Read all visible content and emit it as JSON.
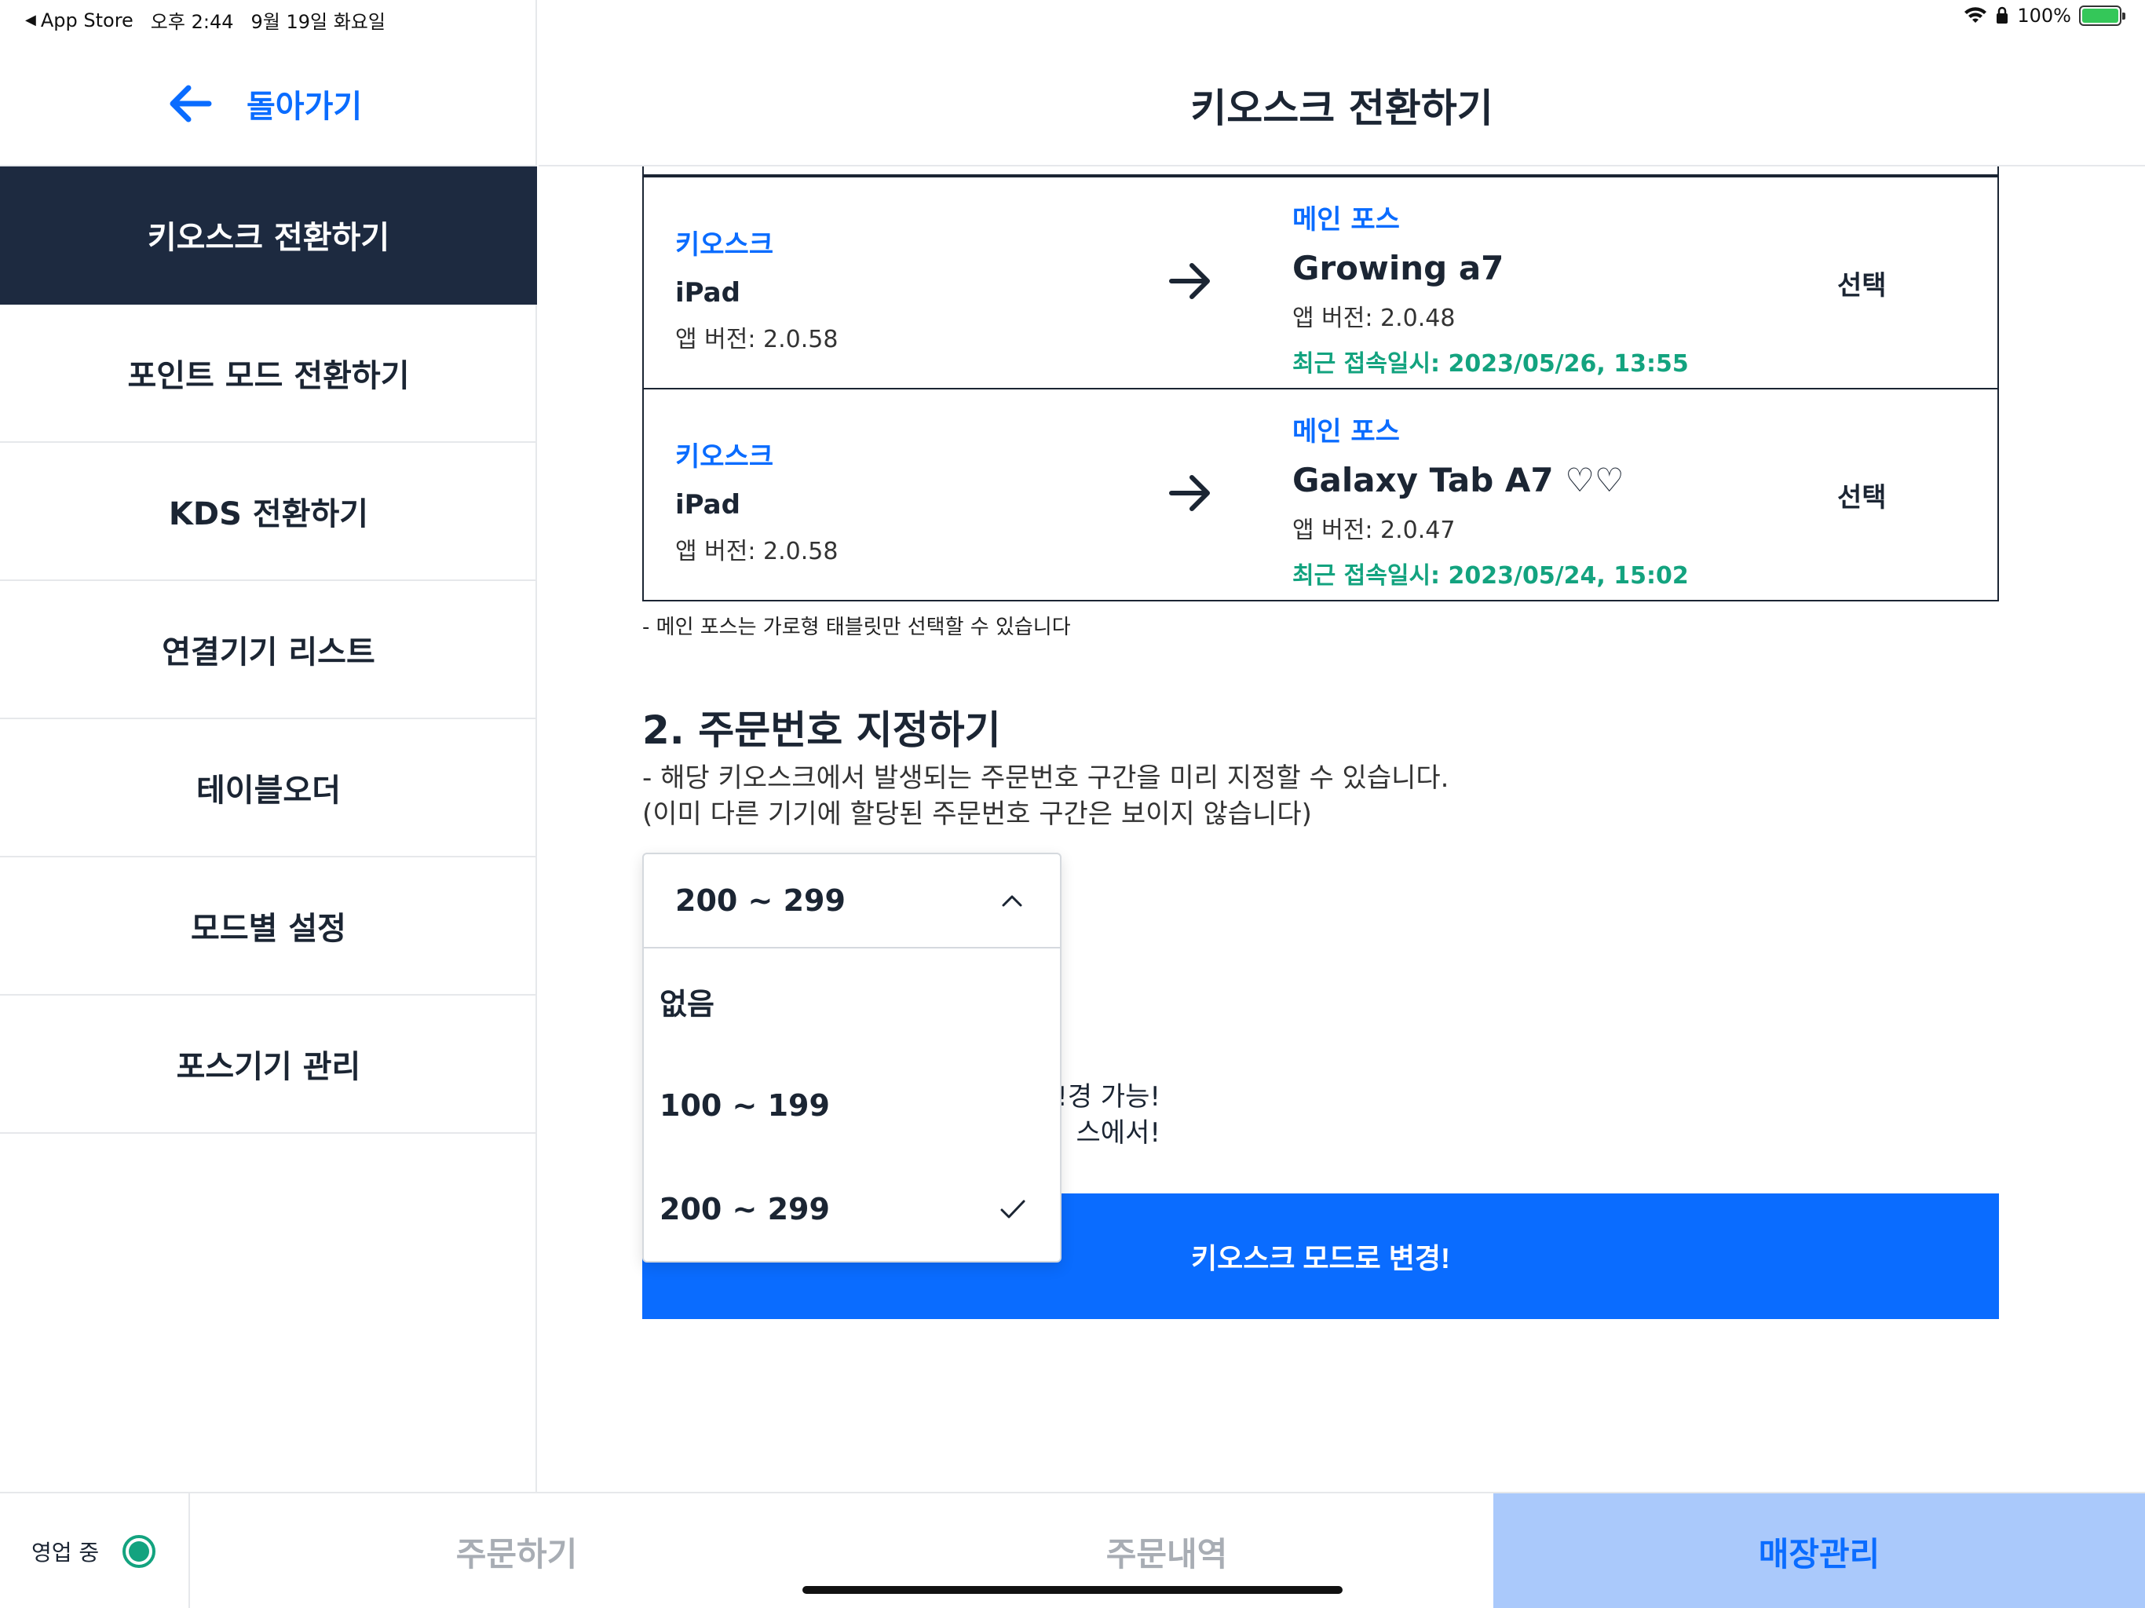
{
  "status_bar": {
    "back_app": "App Store",
    "time": "오후 2:44",
    "date": "9월 19일 화요일",
    "battery": "100%",
    "battery_color": "#34c759"
  },
  "sidebar": {
    "back_label": "돌아가기",
    "items": [
      {
        "label": "키오스크 전환하기",
        "active": true
      },
      {
        "label": "포인트 모드 전환하기"
      },
      {
        "label": "KDS 전환하기"
      },
      {
        "label": "연결기기 리스트"
      },
      {
        "label": "테이블오더"
      },
      {
        "label": "모드별 설정"
      },
      {
        "label": "포스기기 관리"
      }
    ]
  },
  "header": {
    "title": "키오스크 전환하기"
  },
  "devices": [
    {
      "source_tag": "키오스크",
      "source_name": "iPad",
      "source_version": "앱 버전: 2.0.58",
      "target_tag": "메인 포스",
      "target_name": "Growing a7",
      "target_version": "앱 버전: 2.0.48",
      "last_connected": "최근 접속일시: 2023/05/26, 13:55",
      "select_label": "선택"
    },
    {
      "source_tag": "키오스크",
      "source_name": "iPad",
      "source_version": "앱 버전: 2.0.58",
      "target_tag": "메인 포스",
      "target_name": "Galaxy Tab A7 ♡♡",
      "target_version": "앱 버전: 2.0.47",
      "last_connected": "최근 접속일시: 2023/05/24, 15:02",
      "select_label": "선택"
    }
  ],
  "note": "- 메인 포스는 가로형 태블릿만 선택할 수 있습니다",
  "section2": {
    "title": "2. 주문번호 지정하기",
    "desc_line1": "- 해당 키오스크에서 발생되는 주문번호 구간을 미리 지정할 수 있습니다.",
    "desc_line2": "(이미 다른 기기에 할당된 주문번호 구간은 보이지 않습니다)",
    "partial_line1": "!경 가능!",
    "partial_line2": "스에서!"
  },
  "dropdown": {
    "selected": "200 ~ 299",
    "options": [
      "없음",
      "100 ~ 199",
      "200 ~ 299"
    ]
  },
  "primary_button": "키오스크 모드로 변경!",
  "bottom_bar": {
    "status": "영업 중",
    "tabs": [
      "주문하기",
      "주문내역",
      "매장관리"
    ]
  },
  "colors": {
    "accent": "#0a6cff",
    "sidebar_active": "#1d2a40",
    "success": "#13a37f",
    "tab_active_bg": "#aac9fb"
  }
}
